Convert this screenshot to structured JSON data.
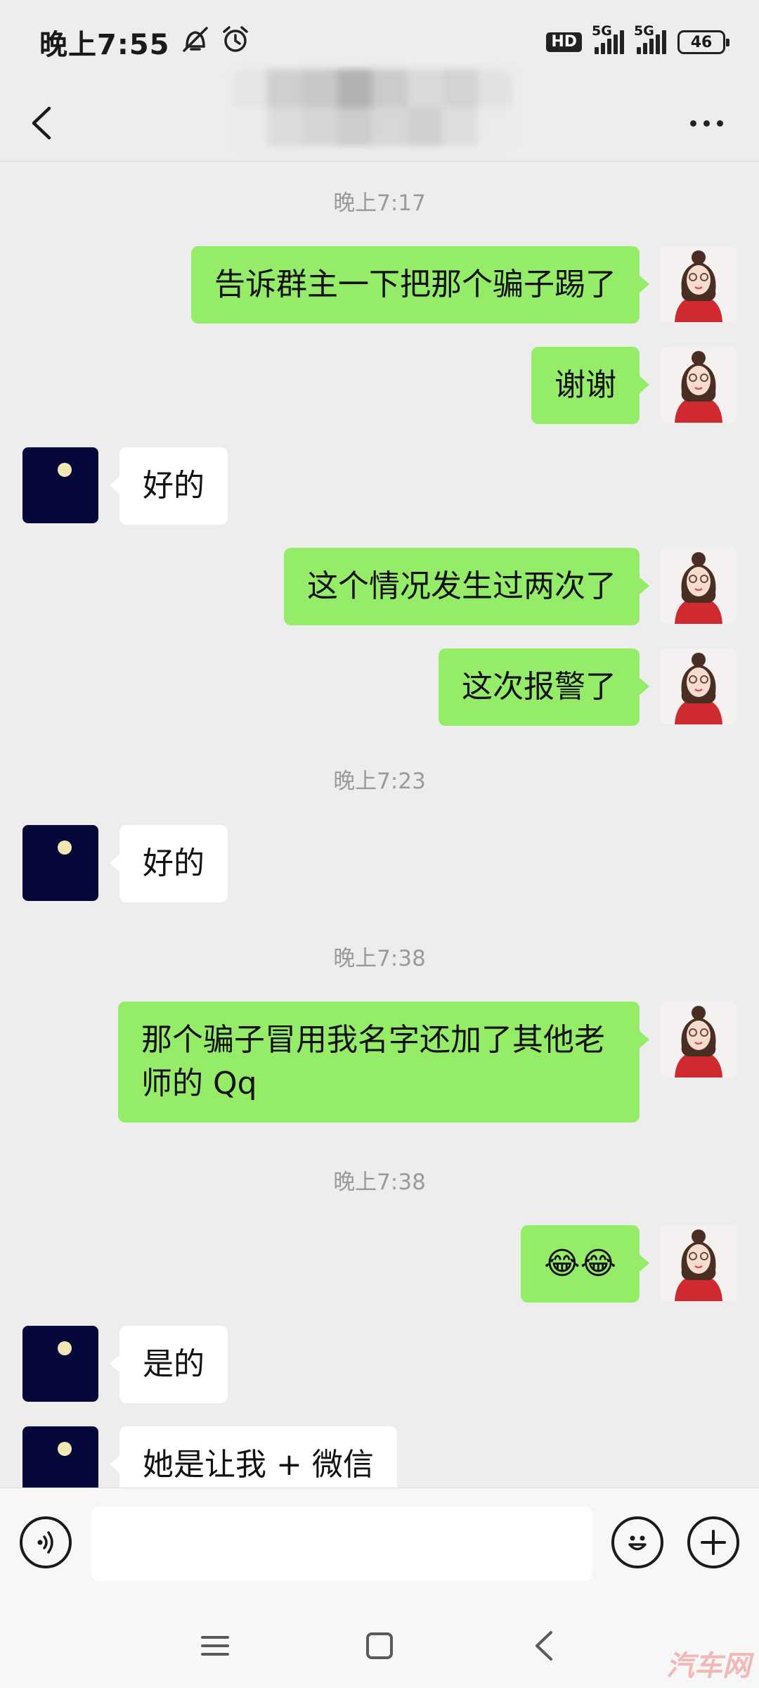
{
  "status_bar": {
    "time": "晚上7:55",
    "network": "5G",
    "network2": "5G",
    "hd": "HD",
    "battery": "46"
  },
  "nav": {
    "back_icon": "chevron-left-icon",
    "more_icon": "more-dots-icon"
  },
  "messages": [
    {
      "type": "time",
      "text": "晚上7:17"
    },
    {
      "type": "me",
      "text": "告诉群主一下把那个骗子踢了"
    },
    {
      "type": "me",
      "text": "谢谢"
    },
    {
      "type": "other",
      "text": "好的"
    },
    {
      "type": "me",
      "text": "这个情况发生过两次了"
    },
    {
      "type": "me",
      "text": "这次报警了"
    },
    {
      "type": "time",
      "text": "晚上7:23"
    },
    {
      "type": "other",
      "text": "好的"
    },
    {
      "type": "time",
      "text": "晚上7:38"
    },
    {
      "type": "me",
      "text": "那个骗子冒用我名字还加了其他老师的 Qq"
    },
    {
      "type": "time",
      "text": "晚上7:38"
    },
    {
      "type": "me",
      "text": "😂😂"
    },
    {
      "type": "other",
      "text": "是的"
    },
    {
      "type": "other",
      "text": "她是让我 + 微信"
    }
  ],
  "input_bar": {
    "voice_icon": "voice-icon",
    "emoji_icon": "emoji-icon",
    "plus_icon": "plus-icon",
    "placeholder": ""
  },
  "system_nav": {
    "menu_icon": "menu-icon",
    "home_icon": "home-icon",
    "back_icon": "back-icon"
  },
  "watermark": "汽车网",
  "colors": {
    "bubble_me": "#95ec69",
    "bubble_other": "#ffffff",
    "background": "#ededed"
  }
}
